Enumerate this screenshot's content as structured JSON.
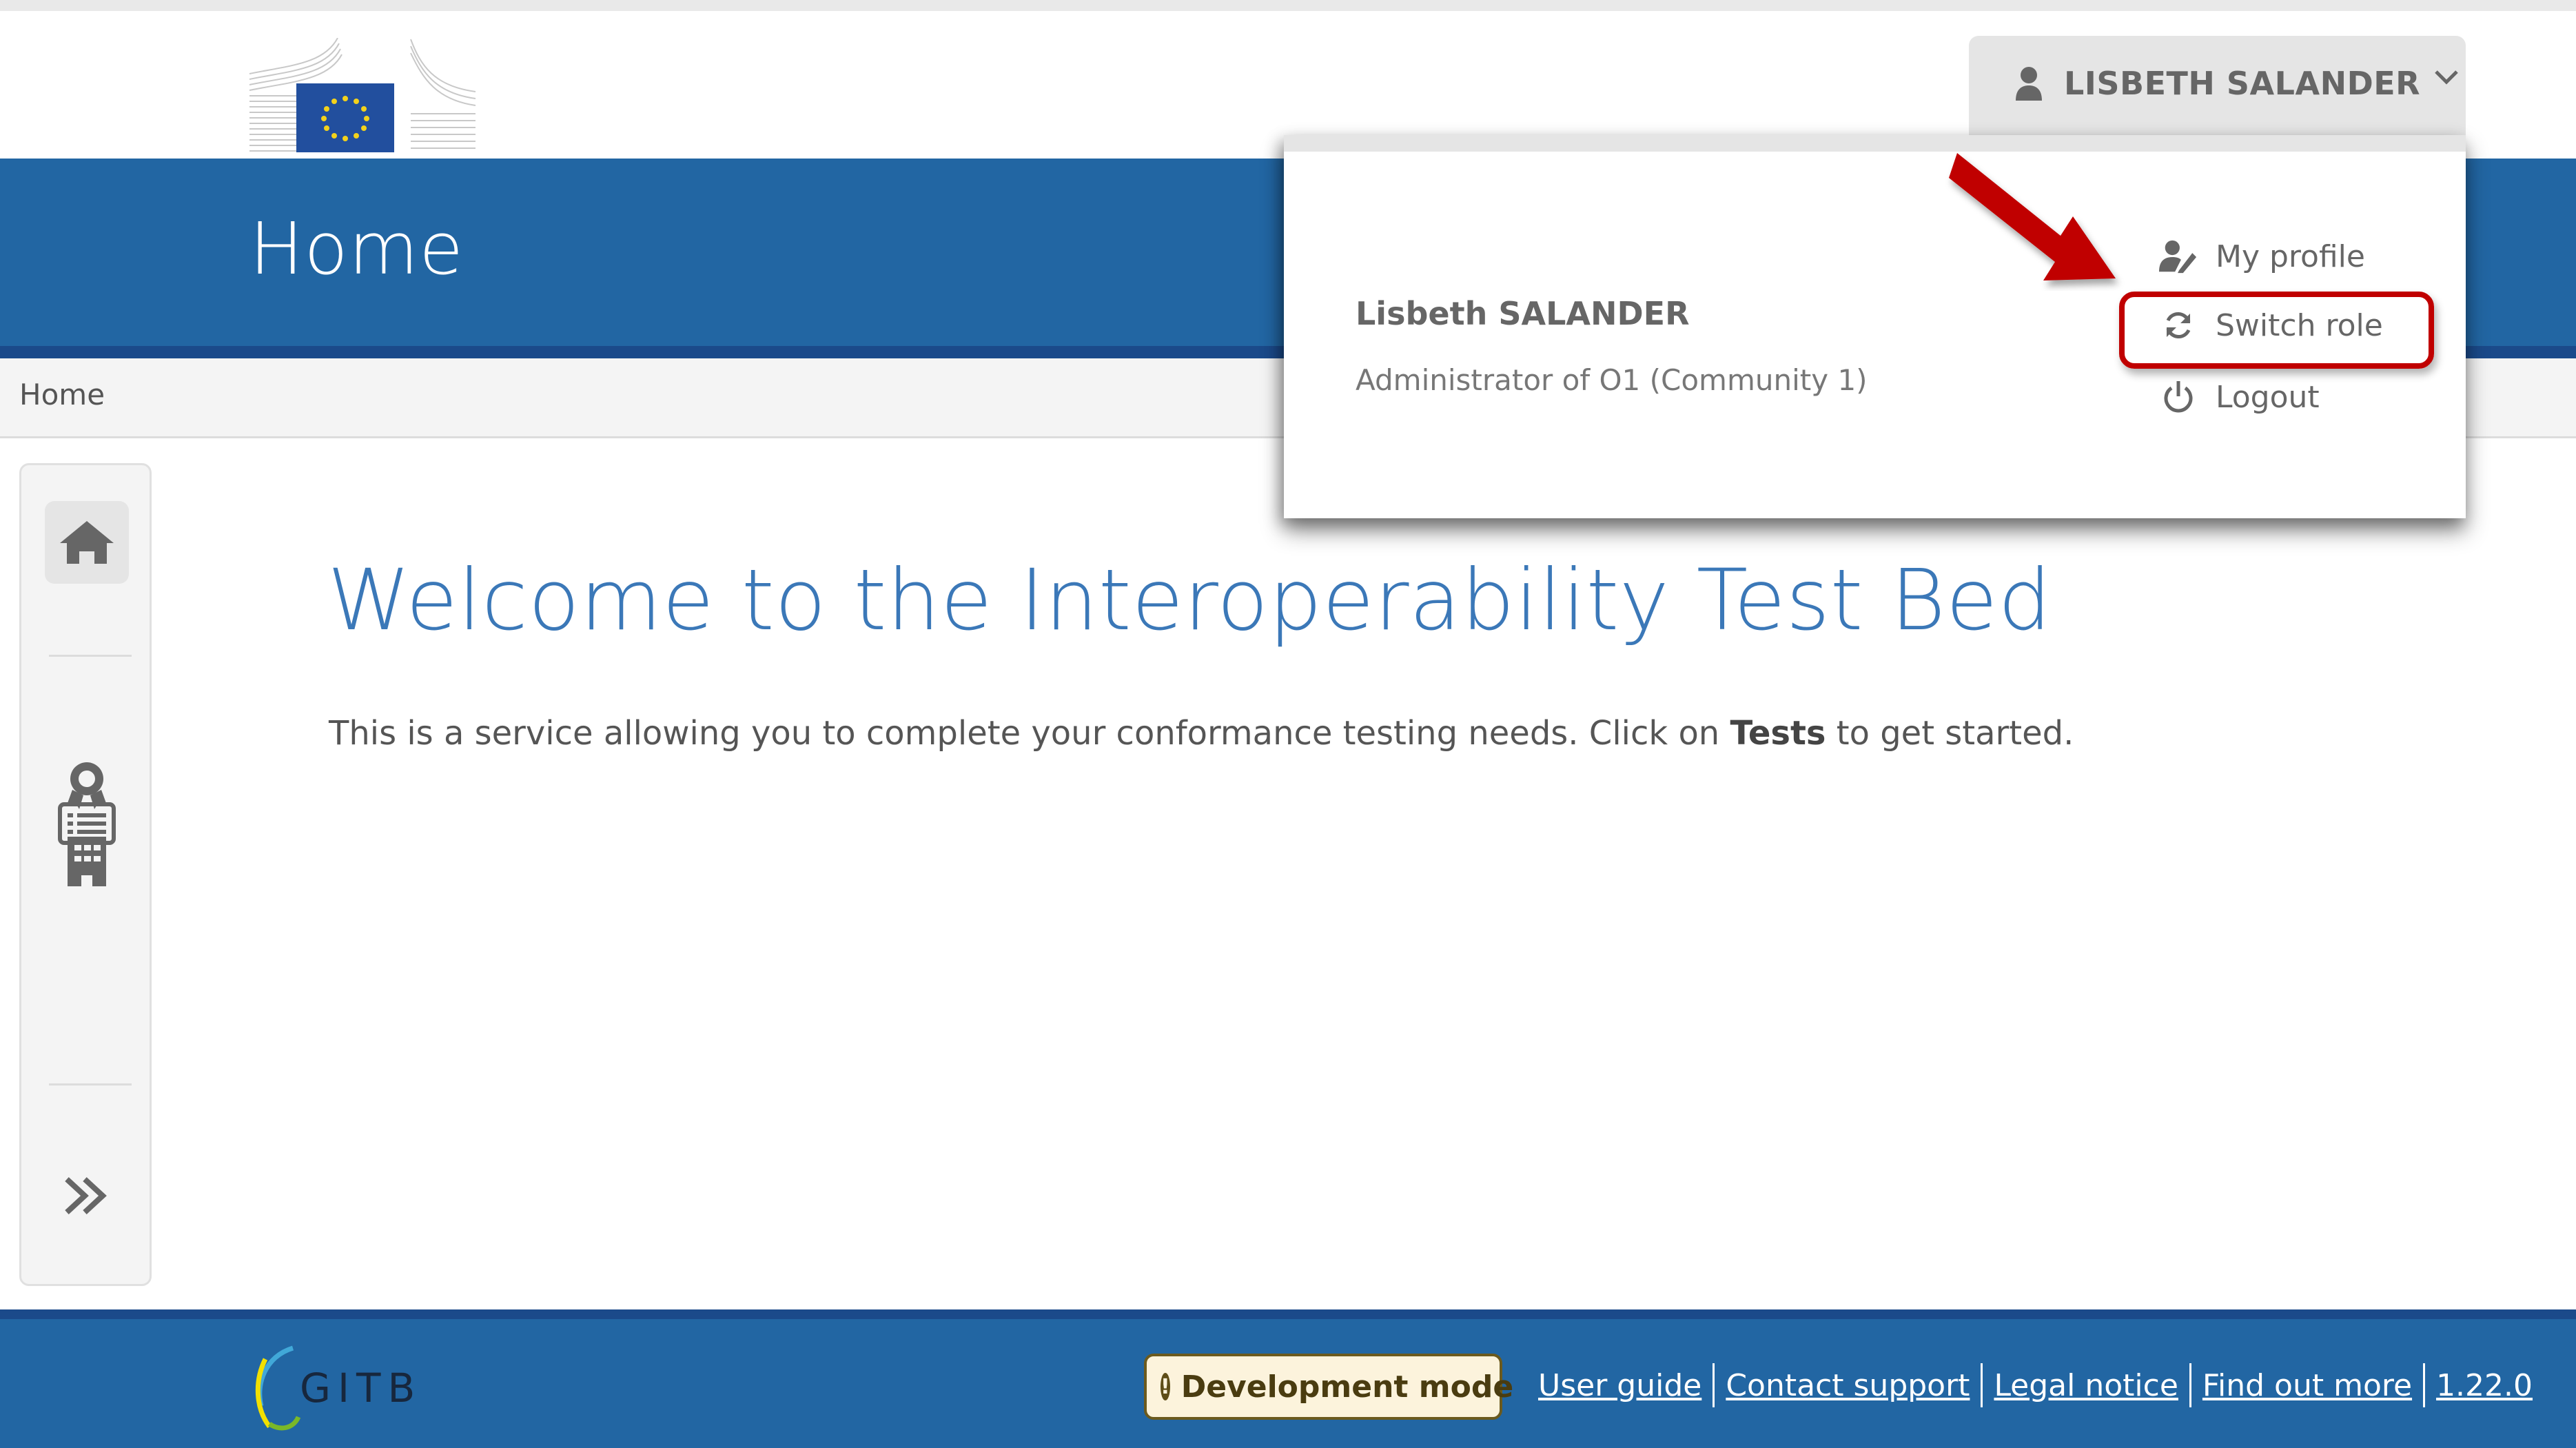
{
  "header": {
    "logo": "european-commission-logo",
    "page_title": "Home"
  },
  "breadcrumb": {
    "items": [
      "Home"
    ]
  },
  "user_menu": {
    "button_label": "LISBETH SALANDER",
    "user_icon": "user-icon",
    "chevron_icon": "chevron-down-icon",
    "dropdown": {
      "full_name": "Lisbeth SALANDER",
      "role": "Administrator of O1 (Community 1)",
      "items": [
        {
          "label": "My profile",
          "icon": "user-edit-icon"
        },
        {
          "label": "Switch role",
          "icon": "sync-icon"
        },
        {
          "label": "Logout",
          "icon": "power-icon"
        }
      ]
    }
  },
  "annotation": {
    "arrow_color": "#c00000",
    "highlighted_item": "Switch role"
  },
  "sidebar": {
    "items": [
      {
        "name": "home",
        "icon": "home-icon",
        "active": true
      },
      {
        "name": "conformance",
        "icon": "award-icon"
      },
      {
        "name": "tests",
        "icon": "list-icon"
      },
      {
        "name": "organisation",
        "icon": "building-icon"
      },
      {
        "name": "expand",
        "icon": "double-chevron-right-icon"
      }
    ]
  },
  "main": {
    "heading": "Welcome to the Interoperability Test Bed",
    "intro_before": "This is a service allowing you to complete your conformance testing needs. Click on ",
    "intro_bold": "Tests",
    "intro_after": " to get started."
  },
  "footer": {
    "logo_text": "GITB",
    "dev_badge": "Development mode",
    "links": [
      "User guide",
      "Contact support",
      "Legal notice",
      "Find out more",
      "1.22.0"
    ]
  },
  "colors": {
    "brand_blue": "#2266a3",
    "brand_blue_dark": "#1b4a8a",
    "heading_blue": "#3b78b8",
    "highlight_red": "#c00000",
    "badge_bg": "#fcf3dc"
  }
}
